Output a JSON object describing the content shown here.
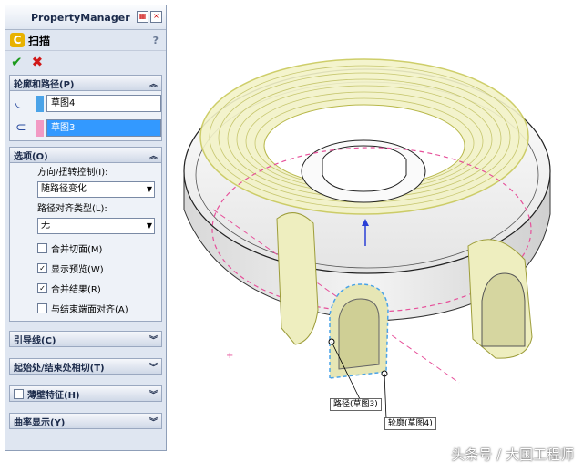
{
  "panel": {
    "title": "PropertyManager",
    "feature_name": "扫描",
    "help": "?",
    "ok_symbol": "✔",
    "cancel_symbol": "✖"
  },
  "profile_group": {
    "title": "轮廓和路径(P)",
    "profile_value": "草图4",
    "path_value": "草图3",
    "profile_color": "#4aa3e8",
    "path_color": "#f29ac4"
  },
  "options_group": {
    "title": "选项(O)",
    "orient_label": "方向/扭转控制(I):",
    "orient_value": "随路径变化",
    "path_align_label": "路径对齐类型(L):",
    "path_align_value": "无",
    "checkboxes": [
      {
        "label": "合并切面(M)",
        "checked": false
      },
      {
        "label": "显示预览(W)",
        "checked": true
      },
      {
        "label": "合并结果(R)",
        "checked": true
      },
      {
        "label": "与结束端面对齐(A)",
        "checked": false
      }
    ]
  },
  "collapsed_groups": [
    {
      "label": "引导线(C)"
    },
    {
      "label": "起始处/结束处相切(T)"
    },
    {
      "label": "薄壁特征(H)"
    },
    {
      "label": "曲率显示(Y)"
    }
  ],
  "viewport": {
    "callout_path": "路径(草图3)",
    "callout_profile": "轮廓(草图4)"
  },
  "watermark": "头条号 / 大国工程师"
}
